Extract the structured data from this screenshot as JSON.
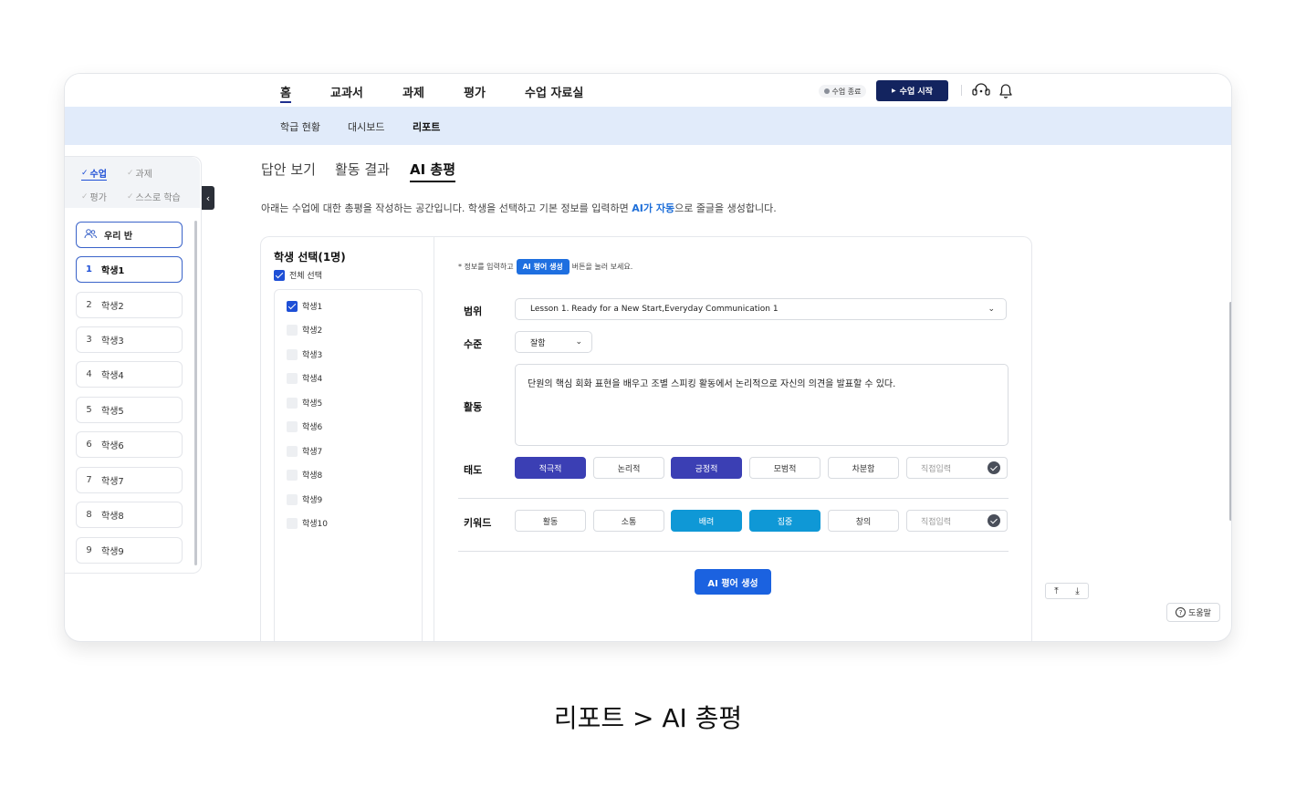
{
  "topnav": {
    "items": [
      "홈",
      "교과서",
      "과제",
      "평가",
      "수업 자료실"
    ],
    "status_label": "수업 종료",
    "start_label": "수업 시작",
    "icons": [
      "headset-icon",
      "bell-icon"
    ]
  },
  "subnav": {
    "items": [
      "학급 현황",
      "대시보드",
      "리포트"
    ]
  },
  "sidebar": {
    "tabs": [
      "수업",
      "과제",
      "평가",
      "스스로 학습"
    ],
    "class_label": "우리 반",
    "students": [
      {
        "num": "1",
        "name": "학생1"
      },
      {
        "num": "2",
        "name": "학생2"
      },
      {
        "num": "3",
        "name": "학생3"
      },
      {
        "num": "4",
        "name": "학생4"
      },
      {
        "num": "5",
        "name": "학생5"
      },
      {
        "num": "6",
        "name": "학생6"
      },
      {
        "num": "7",
        "name": "학생7"
      },
      {
        "num": "8",
        "name": "학생8"
      },
      {
        "num": "9",
        "name": "학생9"
      }
    ]
  },
  "main": {
    "tabs": [
      "답안 보기",
      "활동 결과",
      "AI 총평"
    ],
    "desc_before": "아래는 수업에 대한 총평을 작성하는 공간입니다. 학생을 선택하고 기본 정보를 입력하면 ",
    "desc_highlight": "AI가 자동",
    "desc_after": "으로 줄글을 생성합니다."
  },
  "selector": {
    "title": "학생 선택(1명)",
    "select_all": "전체 선택",
    "students": [
      "학생1",
      "학생2",
      "학생3",
      "학생4",
      "학생5",
      "학생6",
      "학생7",
      "학생8",
      "학생9",
      "학생10"
    ]
  },
  "form": {
    "hint_before": "* 정보를 입력하고",
    "hint_pill": "AI 평어 생성",
    "hint_after": "버튼을 눌러 보세요.",
    "range_label": "범위",
    "range_value": "Lesson 1. Ready for a New Start,Everyday Communication 1",
    "level_label": "수준",
    "level_value": "잘함",
    "activity_label": "활동",
    "activity_text": "단원의 핵심 회화 표현을 배우고 조별 스피킹 활동에서 논리적으로 자신의 의견을 발표할 수 있다.",
    "attitude_label": "태도",
    "attitude_chips": [
      "적극적",
      "논리적",
      "긍정적",
      "모범적",
      "차분함"
    ],
    "keyword_label": "키워드",
    "keyword_chips": [
      "활동",
      "소통",
      "배려",
      "집중",
      "창의"
    ],
    "custom_input_placeholder": "직접입력",
    "generate_button": "AI 평어 생성"
  },
  "footer": {
    "help_label": "도움말"
  },
  "caption": "리포트 > AI 총평",
  "colors": {
    "accent_navy": "#13245f",
    "primary_blue": "#1b62e0",
    "chip_indigo": "#3b3fb4",
    "chip_sky": "#0f98d6",
    "subnav_bg": "#e1ebfa"
  }
}
